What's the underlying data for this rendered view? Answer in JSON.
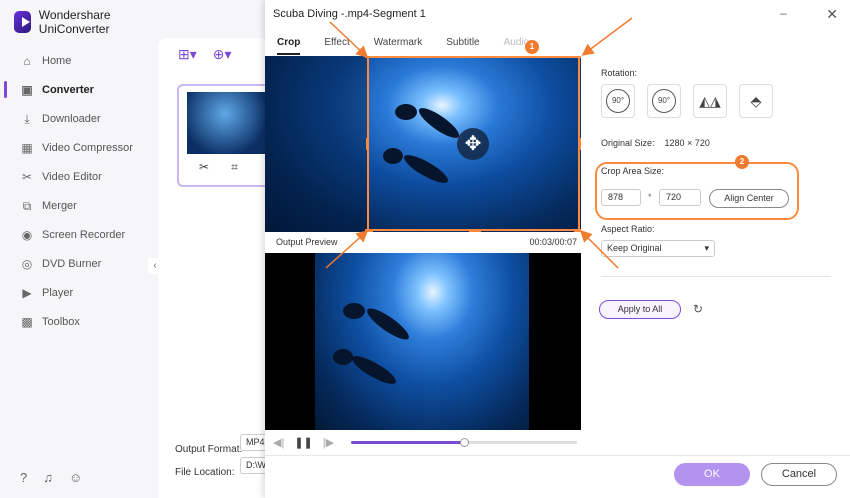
{
  "app": {
    "name": "Wondershare UniConverter"
  },
  "sidebar": {
    "items": [
      {
        "label": "Home",
        "icon": "home-icon"
      },
      {
        "label": "Converter",
        "icon": "converter-icon",
        "active": true
      },
      {
        "label": "Downloader",
        "icon": "download-icon"
      },
      {
        "label": "Video Compressor",
        "icon": "compress-icon"
      },
      {
        "label": "Video Editor",
        "icon": "scissors-icon"
      },
      {
        "label": "Merger",
        "icon": "merge-icon"
      },
      {
        "label": "Screen Recorder",
        "icon": "record-icon"
      },
      {
        "label": "DVD Burner",
        "icon": "disc-icon"
      },
      {
        "label": "Player",
        "icon": "play-icon"
      },
      {
        "label": "Toolbox",
        "icon": "grid-icon"
      }
    ]
  },
  "converter": {
    "output_format_label": "Output Format:",
    "output_format_value": "MP4",
    "file_location_label": "File Location:",
    "file_location_value": "D:\\W"
  },
  "dialog": {
    "title": "Scuba Diving -.mp4-Segment 1",
    "tabs": [
      {
        "label": "Crop",
        "state": "active"
      },
      {
        "label": "Effect",
        "state": "normal"
      },
      {
        "label": "Watermark",
        "state": "normal"
      },
      {
        "label": "Subtitle",
        "state": "normal"
      },
      {
        "label": "Audio",
        "state": "disabled"
      }
    ],
    "output_preview_label": "Output Preview",
    "time": "00:03/00:07",
    "playback_progress": 0.5,
    "rotation_label": "Rotation:",
    "rotation_buttons": [
      "90°",
      "90°"
    ],
    "original_size_label": "Original Size:",
    "original_size_value": "1280 × 720",
    "crop_area_label": "Crop Area Size:",
    "crop_width": "878",
    "crop_height": "720",
    "crop_separator": "*",
    "align_center": "Align Center",
    "aspect_ratio_label": "Aspect Ratio:",
    "aspect_ratio_value": "Keep Original",
    "apply_all": "Apply to All",
    "ok": "OK",
    "cancel": "Cancel",
    "callouts": [
      "1",
      "2"
    ]
  },
  "colors": {
    "accent": "#7b4bd8",
    "annotation": "#f07b2e"
  }
}
